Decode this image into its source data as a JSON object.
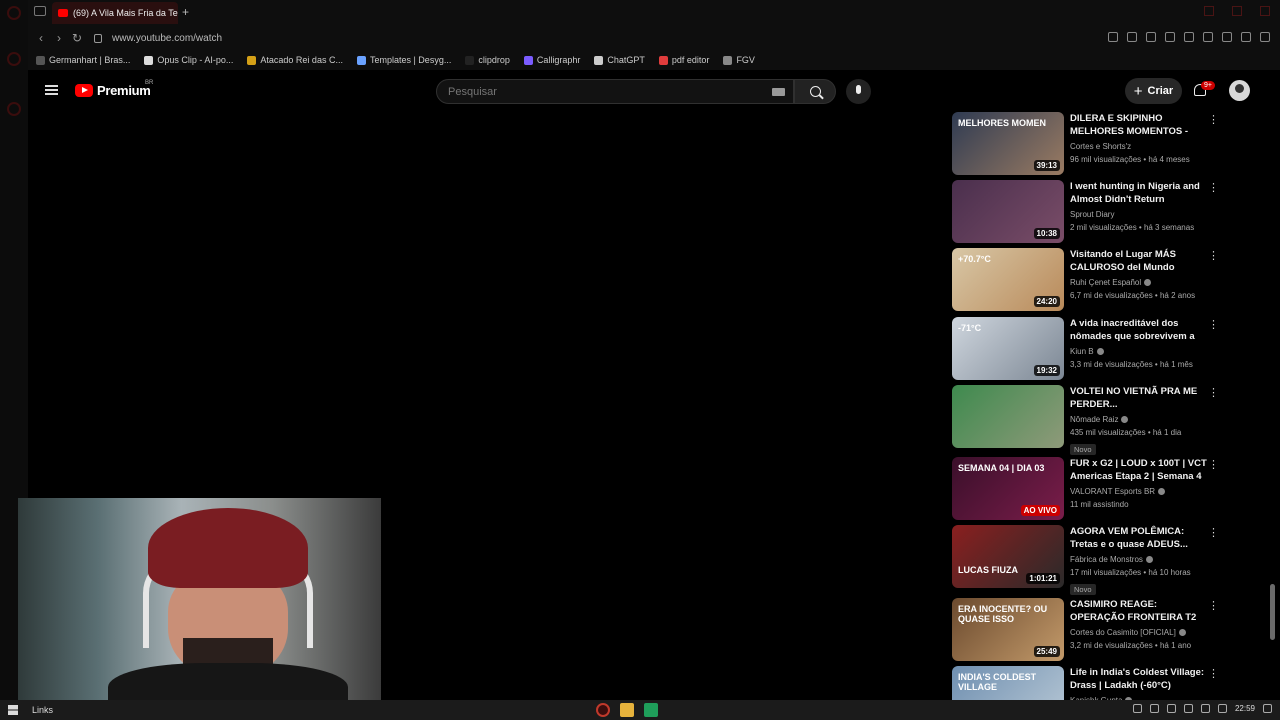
{
  "browser": {
    "tab_title": "(69) A Vila Mais Fria da Te",
    "url": "www.youtube.com/watch",
    "bookmarks": [
      {
        "label": "Germanhart | Bras...",
        "color": "#555555"
      },
      {
        "label": "Opus Clip - AI-po...",
        "color": "#dddddd"
      },
      {
        "label": "Atacado Rei das C...",
        "color": "#d4a017"
      },
      {
        "label": "Templates | Desyg...",
        "color": "#6aa2ff"
      },
      {
        "label": "clipdrop",
        "color": "#222222"
      },
      {
        "label": "Calligraphr",
        "color": "#7b5cff"
      },
      {
        "label": "ChatGPT",
        "color": "#cccccc"
      },
      {
        "label": "pdf editor",
        "color": "#e03c3c"
      },
      {
        "label": "FGV",
        "color": "#888888"
      }
    ]
  },
  "youtube": {
    "brand": "Premium",
    "country": "BR",
    "search_placeholder": "Pesquisar",
    "create_label": "Criar",
    "notif_count": "9+"
  },
  "recommendations": [
    {
      "title": "DILERA E SKIPINHO MELHORES MOMENTOS - Flow #228",
      "channel": "Cortes e Shorts'z",
      "verified": false,
      "meta": "96 mil visualizações • há 4 meses",
      "duration": "39:13",
      "new": false,
      "thumb": [
        "#2f3b52",
        "#9a7b62"
      ],
      "thumb_text": "MELHORES MOMEN"
    },
    {
      "title": "I went hunting in Nigeria and Almost Didn't Return",
      "channel": "Sprout Diary",
      "verified": false,
      "meta": "2 mil visualizações • há 3 semanas",
      "duration": "10:38",
      "new": false,
      "thumb": [
        "#4a2f4d",
        "#7a4d68"
      ],
      "thumb_text": ""
    },
    {
      "title": "Visitando el Lugar MÁS CALUROSO del Mundo (70.7°C...",
      "channel": "Ruhi Çenet Español",
      "verified": true,
      "meta": "6,7 mi de visualizações • há 2 anos",
      "duration": "24:20",
      "new": false,
      "thumb": [
        "#d8c7a6",
        "#b98a5a"
      ],
      "thumb_text": "+70.7°C"
    },
    {
      "title": "A vida inacreditável dos nômades que sobrevivem a –...",
      "channel": "Kiun B",
      "verified": true,
      "meta": "3,3 mi de visualizações • há 1 mês",
      "duration": "19:32",
      "new": false,
      "thumb": [
        "#cfd6de",
        "#7c8794"
      ],
      "thumb_text": "-71°C"
    },
    {
      "title": "VOLTEI NO VIETNÃ PRA ME PERDER...",
      "channel": "Nômade Raiz",
      "verified": true,
      "meta": "435 mil visualizações • há 1 dia",
      "duration": "",
      "new": true,
      "thumb": [
        "#3e8a4e",
        "#8f9a7a"
      ],
      "thumb_text": ""
    },
    {
      "title": "FUR x G2 | LOUD x 100T | VCT Americas Etapa 2 | Semana 4 -...",
      "channel": "VALORANT Esports BR",
      "verified": true,
      "meta": "11 mil assistindo",
      "duration": "",
      "live": "AO VIVO",
      "new": false,
      "thumb": [
        "#3a0f2a",
        "#7a1d4a"
      ],
      "thumb_text": "SEMANA 04 | DIA 03"
    },
    {
      "title": "AGORA VEM POLÊMICA: Tretas e o quase ADEUS... Lucas Fiuz...",
      "channel": "Fábrica de Monstros",
      "verified": true,
      "meta": "17 mil visualizações • há 10 horas",
      "duration": "1:01:21",
      "new": true,
      "thumb": [
        "#8a1f1f",
        "#2a2a2a"
      ],
      "thumb_text": "LUCAS FIUZA"
    },
    {
      "title": "CASIMIRO REAGE: OPERAÇÃO FRONTEIRA T2 #22 - PEGARA...",
      "channel": "Cortes do Casimito [OFICIAL]",
      "verified": true,
      "meta": "3,2 mi de visualizações • há 1 ano",
      "duration": "25:49",
      "new": false,
      "thumb": [
        "#6b4a2e",
        "#c39a6a"
      ],
      "thumb_text": "ERA INOCENTE? OU QUASE ISSO"
    },
    {
      "title": "Life in India's Coldest Village: Drass | Ladakh (-60°C)",
      "channel": "Kanishk Gupta",
      "verified": true,
      "meta": "",
      "duration": "",
      "new": false,
      "thumb": [
        "#6f8fb0",
        "#b9c9d6"
      ],
      "thumb_text": "INDIA'S COLDEST VILLAGE"
    }
  ],
  "taskbar": {
    "label": "Links",
    "time": "22:59"
  }
}
